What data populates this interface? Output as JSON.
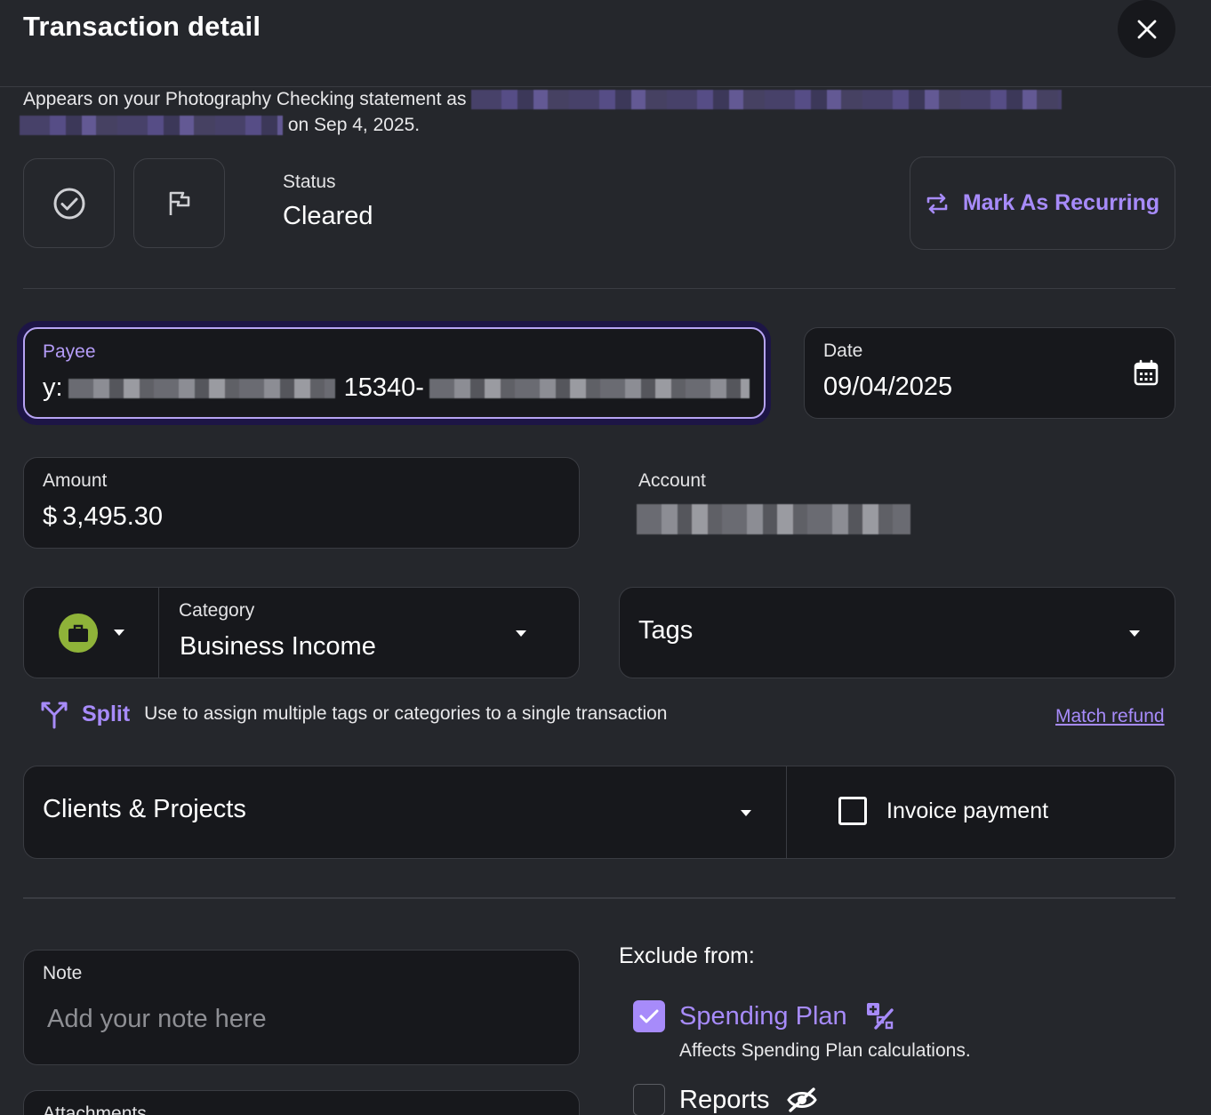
{
  "header": {
    "title": "Transaction detail",
    "close_icon": "close-icon"
  },
  "statement": {
    "prefix": "Appears on your Photography Checking statement as",
    "suffix": "on Sep 4, 2025."
  },
  "status": {
    "label": "Status",
    "value": "Cleared",
    "cleared_icon": "check-circle-icon",
    "flag_icon": "flag-icon"
  },
  "recurring": {
    "label": "Mark As Recurring",
    "icon": "repeat-icon"
  },
  "payee": {
    "label": "Payee",
    "value_start": "y:",
    "value_mid": "15340-"
  },
  "date": {
    "label": "Date",
    "value": "09/04/2025",
    "icon": "calendar-icon"
  },
  "amount": {
    "label": "Amount",
    "currency": "$",
    "value": "3,495.30"
  },
  "account": {
    "label": "Account"
  },
  "category": {
    "label": "Category",
    "value": "Business Income",
    "icon": "briefcase-icon",
    "icon_color": "#8fb339"
  },
  "tags": {
    "placeholder": "Tags"
  },
  "split": {
    "label": "Split",
    "description": "Use to assign multiple tags or categories to a single transaction",
    "icon": "split-icon"
  },
  "match_refund": "Match refund",
  "clients": {
    "label": "Clients & Projects"
  },
  "invoice": {
    "label": "Invoice payment",
    "checked": false
  },
  "note": {
    "label": "Note",
    "placeholder": "Add your note here"
  },
  "attachments": {
    "label": "Attachments"
  },
  "exclude": {
    "title": "Exclude from:",
    "spending_plan": {
      "label": "Spending Plan",
      "description": "Affects Spending Plan calculations.",
      "checked": true,
      "icon": "percent-plus-icon"
    },
    "reports": {
      "label": "Reports",
      "checked": false,
      "icon": "eye-off-icon"
    }
  },
  "colors": {
    "accent": "#a78bfa",
    "background": "#25272c",
    "field_bg": "#17181c"
  }
}
